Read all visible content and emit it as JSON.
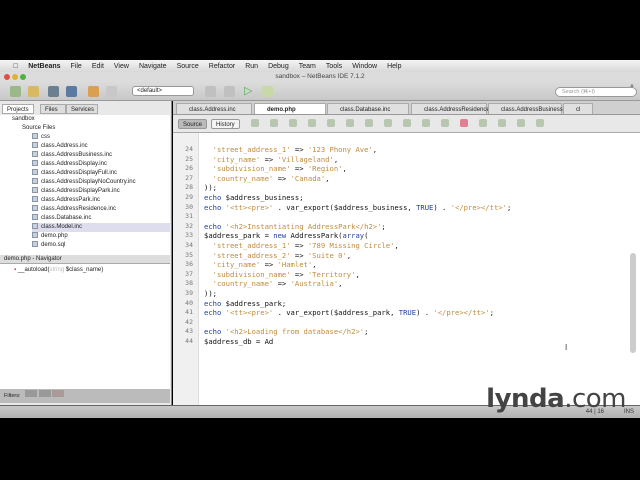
{
  "menu": {
    "apple": "",
    "items": [
      "NetBeans",
      "File",
      "Edit",
      "View",
      "Navigate",
      "Source",
      "Refactor",
      "Run",
      "Debug",
      "Team",
      "Tools",
      "Window",
      "Help"
    ]
  },
  "window_title": "sandbox – NetBeans IDE 7.1.2",
  "toolbar": {
    "config": "<default>",
    "search_placeholder": "Search (⌘+I)"
  },
  "left_tabs": [
    "Projects",
    "Files",
    "Services"
  ],
  "tree": {
    "project": "sandbox",
    "source_files": "Source Files",
    "items": [
      "css",
      "class.Address.inc",
      "class.AddressBusiness.inc",
      "class.AddressDisplay.inc",
      "class.AddressDisplayFull.inc",
      "class.AddressDisplayNoCountry.inc",
      "class.AddressDisplayPark.inc",
      "class.AddressPark.inc",
      "class.AddressResidence.inc",
      "class.Database.inc",
      "class.Model.inc",
      "demo.php",
      "demo.sql"
    ]
  },
  "navigator": {
    "title": "demo.php - Navigator",
    "item_name": "__autoload(",
    "item_type": "string",
    "item_param": " $class_name)"
  },
  "filters_label": "Filters:",
  "editor_tabs": [
    "class.Address.inc",
    "demo.php",
    "class.Database.inc",
    "class.AddressResidence.inc",
    "class.AddressBusiness.inc",
    "cl"
  ],
  "editor_buttons": {
    "source": "Source",
    "history": "History"
  },
  "code": [
    {
      "n": "24",
      "t": [
        [
          "",
          "  "
        ],
        [
          "s",
          "'street_address_1'"
        ],
        [
          "",
          " => "
        ],
        [
          "s",
          "'123 Phony Ave'"
        ],
        [
          "",
          ","
        ]
      ]
    },
    {
      "n": "25",
      "t": [
        [
          "",
          "  "
        ],
        [
          "s",
          "'city_name'"
        ],
        [
          "",
          " => "
        ],
        [
          "s",
          "'Villageland'"
        ],
        [
          "",
          ","
        ]
      ]
    },
    {
      "n": "26",
      "t": [
        [
          "",
          "  "
        ],
        [
          "s",
          "'subdivision_name'"
        ],
        [
          "",
          " => "
        ],
        [
          "s",
          "'Region'"
        ],
        [
          "",
          ","
        ]
      ]
    },
    {
      "n": "27",
      "t": [
        [
          "",
          "  "
        ],
        [
          "s",
          "'country_name'"
        ],
        [
          "",
          " => "
        ],
        [
          "s",
          "'Canada'"
        ],
        [
          "",
          ","
        ]
      ]
    },
    {
      "n": "28",
      "t": [
        [
          "",
          "));"
        ]
      ]
    },
    {
      "n": "29",
      "t": [
        [
          "k",
          "echo"
        ],
        [
          "",
          " $address_business;"
        ]
      ]
    },
    {
      "n": "30",
      "t": [
        [
          "k",
          "echo"
        ],
        [
          "",
          " "
        ],
        [
          "s",
          "'<tt><pre>'"
        ],
        [
          "",
          " . var_export($address_business, "
        ],
        [
          "k",
          "TRUE"
        ],
        [
          "",
          ") . "
        ],
        [
          "s",
          "'</pre></tt>'"
        ],
        [
          "",
          ";"
        ]
      ]
    },
    {
      "n": "31",
      "t": []
    },
    {
      "n": "32",
      "t": [
        [
          "k",
          "echo"
        ],
        [
          "",
          " "
        ],
        [
          "s",
          "'<h2>Instantiating AddressPark</h2>'"
        ],
        [
          "",
          ";"
        ]
      ]
    },
    {
      "n": "33",
      "t": [
        [
          "",
          "$address_park = "
        ],
        [
          "k",
          "new"
        ],
        [
          "",
          " AddressPark("
        ],
        [
          "k",
          "array"
        ],
        [
          "",
          "("
        ]
      ]
    },
    {
      "n": "34",
      "t": [
        [
          "",
          "  "
        ],
        [
          "s",
          "'street_address_1'"
        ],
        [
          "",
          " => "
        ],
        [
          "s",
          "'789 Missing Circle'"
        ],
        [
          "",
          ","
        ]
      ]
    },
    {
      "n": "35",
      "t": [
        [
          "",
          "  "
        ],
        [
          "s",
          "'street_address_2'"
        ],
        [
          "",
          " => "
        ],
        [
          "s",
          "'Suite 0'"
        ],
        [
          "",
          ","
        ]
      ]
    },
    {
      "n": "36",
      "t": [
        [
          "",
          "  "
        ],
        [
          "s",
          "'city_name'"
        ],
        [
          "",
          " => "
        ],
        [
          "s",
          "'Hamlet'"
        ],
        [
          "",
          ","
        ]
      ]
    },
    {
      "n": "37",
      "t": [
        [
          "",
          "  "
        ],
        [
          "s",
          "'subdivision_name'"
        ],
        [
          "",
          " => "
        ],
        [
          "s",
          "'Territory'"
        ],
        [
          "",
          ","
        ]
      ]
    },
    {
      "n": "38",
      "t": [
        [
          "",
          "  "
        ],
        [
          "s",
          "'country_name'"
        ],
        [
          "",
          " => "
        ],
        [
          "s",
          "'Australia'"
        ],
        [
          "",
          ","
        ]
      ]
    },
    {
      "n": "39",
      "t": [
        [
          "",
          "));"
        ]
      ]
    },
    {
      "n": "40",
      "t": [
        [
          "k",
          "echo"
        ],
        [
          "",
          " $address_park;"
        ]
      ]
    },
    {
      "n": "41",
      "t": [
        [
          "k",
          "echo"
        ],
        [
          "",
          " "
        ],
        [
          "s",
          "'<tt><pre>'"
        ],
        [
          "",
          " . var_export($address_park, "
        ],
        [
          "k",
          "TRUE"
        ],
        [
          "",
          ") . "
        ],
        [
          "s",
          "'</pre></tt>'"
        ],
        [
          "",
          ";"
        ]
      ]
    },
    {
      "n": "42",
      "t": []
    },
    {
      "n": "43",
      "t": [
        [
          "k",
          "echo"
        ],
        [
          "",
          " "
        ],
        [
          "s",
          "'<h2>Loading from database</h2>'"
        ],
        [
          "",
          ";"
        ]
      ]
    },
    {
      "n": "44",
      "t": [
        [
          "",
          "$address_db = Ad"
        ]
      ]
    }
  ],
  "status": {
    "position": "44 | 16",
    "mode": "INS"
  },
  "watermark": {
    "brand": "lynda",
    "suffix": ".com"
  }
}
